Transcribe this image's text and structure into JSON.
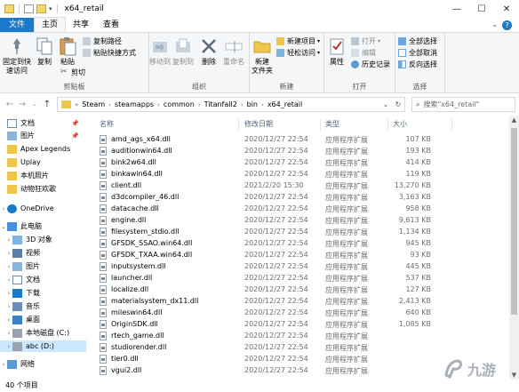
{
  "window": {
    "title": "x64_retail"
  },
  "ribbon_tabs": [
    "文件",
    "主页",
    "共享",
    "查看"
  ],
  "ribbon": {
    "clipboard": {
      "pin_label": "固定到快\n速访问",
      "copy_label": "复制",
      "paste_label": "粘贴",
      "cut_label": "剪切",
      "copy_path_label": "复制路径",
      "paste_shortcut_label": "粘贴快捷方式",
      "group_label": "剪贴板"
    },
    "organize": {
      "move_to_label": "移动到",
      "copy_to_label": "复制到",
      "delete_label": "删除",
      "rename_label": "重命名",
      "group_label": "组织"
    },
    "new": {
      "new_folder_label": "新建\n文件夹",
      "new_item_label": "新建项目",
      "easy_access_label": "轻松访问",
      "group_label": "新建"
    },
    "open": {
      "properties_label": "属性",
      "open_label": "打开",
      "edit_label": "编辑",
      "history_label": "历史记录",
      "group_label": "打开"
    },
    "select": {
      "select_all_label": "全部选择",
      "select_none_label": "全部取消",
      "invert_label": "反向选择",
      "group_label": "选择"
    }
  },
  "address": {
    "crumbs": [
      "Steam",
      "steamapps",
      "common",
      "Titanfall2",
      "bin",
      "x64_retail"
    ],
    "overflow": "«",
    "search_placeholder": "搜索\"x64_retail\""
  },
  "sidebar": {
    "items": [
      {
        "label": "文档",
        "pinned": true
      },
      {
        "label": "图片",
        "pinned": true
      },
      {
        "label": "Apex Legends"
      },
      {
        "label": "Uplay"
      },
      {
        "label": "本机照片"
      },
      {
        "label": "动物狂欢歌"
      },
      {
        "label": "OneDrive"
      },
      {
        "label": "此电脑"
      },
      {
        "label": "3D 对象"
      },
      {
        "label": "视频"
      },
      {
        "label": "图片"
      },
      {
        "label": "文档"
      },
      {
        "label": "下载"
      },
      {
        "label": "音乐"
      },
      {
        "label": "桌面"
      },
      {
        "label": "本地磁盘 (C:)"
      },
      {
        "label": "abc (D:)"
      },
      {
        "label": "网络"
      }
    ]
  },
  "columns": {
    "name": "名称",
    "date": "修改日期",
    "type": "类型",
    "size": "大小"
  },
  "files": [
    {
      "name": "amd_ags_x64.dll",
      "date": "2020/12/27 22:54",
      "type": "应用程序扩展",
      "size": "107 KB"
    },
    {
      "name": "auditionwin64.dll",
      "date": "2020/12/27 22:54",
      "type": "应用程序扩展",
      "size": "193 KB"
    },
    {
      "name": "bink2w64.dll",
      "date": "2020/12/27 22:54",
      "type": "应用程序扩展",
      "size": "414 KB"
    },
    {
      "name": "binkawin64.dll",
      "date": "2020/12/27 22:54",
      "type": "应用程序扩展",
      "size": "119 KB"
    },
    {
      "name": "client.dll",
      "date": "2021/2/20 15:30",
      "type": "应用程序扩展",
      "size": "13,270 KB"
    },
    {
      "name": "d3dcompiler_46.dll",
      "date": "2020/12/27 22:54",
      "type": "应用程序扩展",
      "size": "3,163 KB"
    },
    {
      "name": "datacache.dll",
      "date": "2020/12/27 22:54",
      "type": "应用程序扩展",
      "size": "958 KB"
    },
    {
      "name": "engine.dll",
      "date": "2020/12/27 22:54",
      "type": "应用程序扩展",
      "size": "9,613 KB"
    },
    {
      "name": "filesystem_stdio.dll",
      "date": "2020/12/27 22:54",
      "type": "应用程序扩展",
      "size": "1,134 KB"
    },
    {
      "name": "GFSDK_SSAO.win64.dll",
      "date": "2020/12/27 22:54",
      "type": "应用程序扩展",
      "size": "945 KB"
    },
    {
      "name": "GFSDK_TXAA.win64.dll",
      "date": "2020/12/27 22:54",
      "type": "应用程序扩展",
      "size": "93 KB"
    },
    {
      "name": "inputsystem.dll",
      "date": "2020/12/27 22:54",
      "type": "应用程序扩展",
      "size": "445 KB"
    },
    {
      "name": "launcher.dll",
      "date": "2020/12/27 22:54",
      "type": "应用程序扩展",
      "size": "537 KB"
    },
    {
      "name": "localize.dll",
      "date": "2020/12/27 22:54",
      "type": "应用程序扩展",
      "size": "127 KB"
    },
    {
      "name": "materialsystem_dx11.dll",
      "date": "2020/12/27 22:54",
      "type": "应用程序扩展",
      "size": "2,413 KB"
    },
    {
      "name": "mileswin64.dll",
      "date": "2020/12/27 22:54",
      "type": "应用程序扩展",
      "size": "640 KB"
    },
    {
      "name": "OriginSDK.dll",
      "date": "2020/12/27 22:54",
      "type": "应用程序扩展",
      "size": "1,085 KB"
    },
    {
      "name": "rtech_game.dll",
      "date": "2020/12/27 22:54",
      "type": "应用程序扩展",
      "size": ""
    },
    {
      "name": "studiorender.dll",
      "date": "2020/12/27 22:54",
      "type": "应用程序扩展",
      "size": ""
    },
    {
      "name": "tier0.dll",
      "date": "2020/12/27 22:54",
      "type": "应用程序扩展",
      "size": ""
    },
    {
      "name": "vgui2.dll",
      "date": "2020/12/27 22:54",
      "type": "应用程序扩展",
      "size": ""
    }
  ],
  "status": {
    "item_count": "40 个项目"
  },
  "watermark": {
    "text": "九游"
  },
  "colors": {
    "accent": "#1979ca",
    "selection": "#cce8ff",
    "folder": "#f0c54b"
  }
}
